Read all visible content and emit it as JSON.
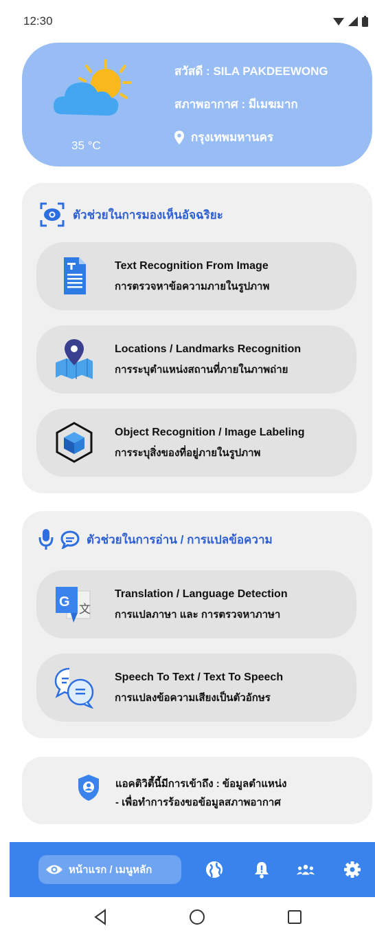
{
  "status": {
    "time": "12:30"
  },
  "weather": {
    "temperature": "35 °C",
    "greeting": "สวัสดี : SILA PAKDEEWONG",
    "condition": "สภาพอากาศ : มีเมฆมาก",
    "location": "กรุงเทพมหานคร",
    "icon": "partly-cloudy-icon"
  },
  "vision": {
    "header": "ตัวช่วยในการมองเห็นอัจฉริยะ",
    "items": [
      {
        "title": "Text Recognition From Image",
        "subtitle": "การตรวจหาข้อความภายในรูปภาพ",
        "icon": "document-icon"
      },
      {
        "title": "Locations / Landmarks Recognition",
        "subtitle": "การระบุตำแหน่งสถานที่ภายในภาพถ่าย",
        "icon": "map-pin-icon"
      },
      {
        "title": "Object Recognition / Image Labeling",
        "subtitle": "การระบุสิ่งของที่อยู่ภายในรูปภาพ",
        "icon": "cube-icon"
      }
    ]
  },
  "reading": {
    "header": "ตัวช่วยในการอ่าน / การแปลข้อความ",
    "items": [
      {
        "title": "Translation / Language Detection",
        "subtitle": "การแปลภาษา และ การตรวจหาภาษา",
        "icon": "translate-icon"
      },
      {
        "title": "Speech To Text / Text To Speech",
        "subtitle": "การแปลงข้อความเสียงเป็นตัวอักษร",
        "icon": "speech-bubbles-icon"
      }
    ]
  },
  "permission": {
    "line1": "แอคติวิตี้นี้มีการเข้าถึง : ข้อมูลตำแหน่ง",
    "line2": "- เพื่อทำการร้องขอข้อมูลสภาพอากาศ",
    "icon": "shield-user-icon"
  },
  "nav": {
    "home_label": "หน้าแรก / เมนูหลัก",
    "items": [
      "globe-icon",
      "bell-icon",
      "people-icon",
      "gear-icon"
    ]
  },
  "colors": {
    "accent": "#3a82ec",
    "header_blue": "#2d5fd3",
    "weather_bg": "#98bdf4"
  }
}
